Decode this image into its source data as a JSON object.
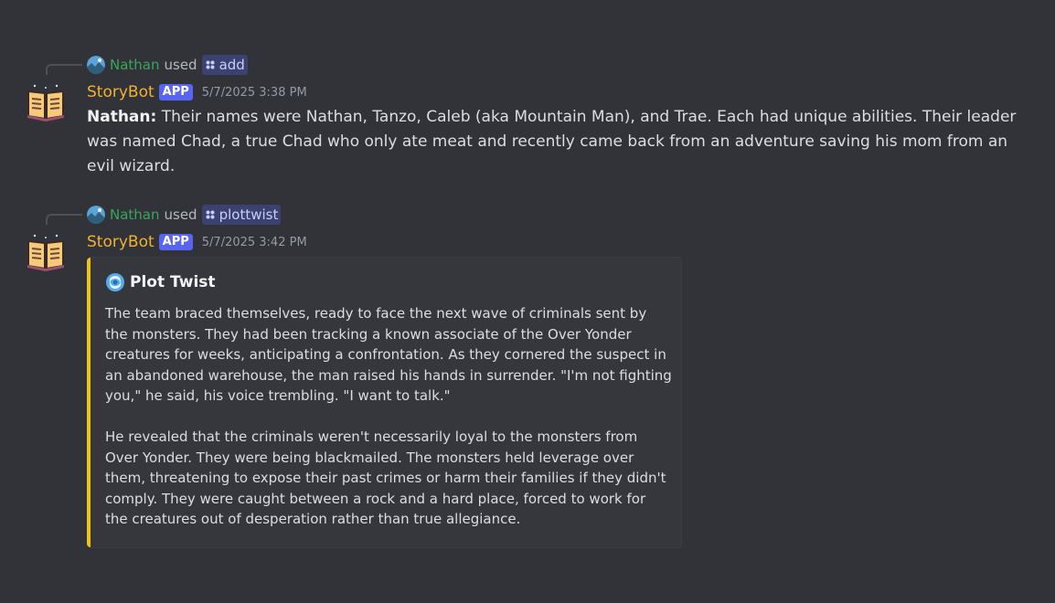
{
  "messages": [
    {
      "interaction": {
        "user": "Nathan",
        "used": "used",
        "command": "add"
      },
      "author": "StoryBot",
      "badge": "APP",
      "timestamp": "5/7/2025 3:38 PM",
      "content": {
        "bold_prefix": "Nathan:",
        "text": " Their names were Nathan, Tanzo, Caleb (aka Mountain Man), and Trae. Each had unique abilities. Their leader was named Chad, a true Chad who only ate meat and recently came back from an adventure saving his mom from an evil wizard."
      }
    },
    {
      "interaction": {
        "user": "Nathan",
        "used": "used",
        "command": "plottwist"
      },
      "author": "StoryBot",
      "badge": "APP",
      "timestamp": "5/7/2025 3:42 PM",
      "embed": {
        "color": "#f1c40f",
        "icon": "cyclone-icon",
        "title": "Plot Twist",
        "paragraphs": [
          "The team braced themselves, ready to face the next wave of criminals sent by the monsters. They had been tracking a known associate of the Over Yonder creatures for weeks, anticipating a confrontation. As they cornered the suspect in an abandoned warehouse, the man raised his hands in surrender. \"I'm not fighting you,\" he said, his voice trembling. \"I want to talk.\"",
          "He revealed that the criminals weren't necessarily loyal to the monsters from Over Yonder. They were being blackmailed. The monsters held leverage over them, threatening to expose their past crimes or harm their families if they didn't comply. They were caught between a rock and a hard place, forced to work for the creatures out of desperation rather than true allegiance."
        ]
      }
    }
  ],
  "colors": {
    "background": "#313338",
    "username_user": "#3ba55c",
    "username_bot": "#f0b232",
    "badge": "#5865f2",
    "embed_accent": "#f1c40f"
  }
}
